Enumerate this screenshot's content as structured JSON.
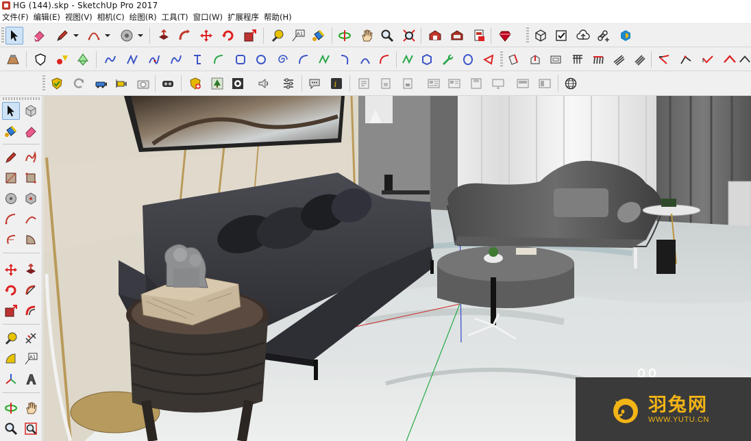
{
  "window": {
    "title": "HG (144).skp - SketchUp Pro 2017"
  },
  "menubar": {
    "items": [
      "文件(F)",
      "编辑(E)",
      "视图(V)",
      "相机(C)",
      "绘图(R)",
      "工具(T)",
      "窗口(W)",
      "扩展程序",
      "帮助(H)"
    ]
  },
  "toolbar_main": {
    "active_tool": "select",
    "tools": [
      "select",
      "eraser",
      "pencil",
      "dropdown",
      "arc",
      "dropdown",
      "protractor",
      "dropdown",
      "push-pull",
      "follow-me",
      "move",
      "rotate",
      "scale",
      "tape-measure",
      "text",
      "paint-bucket",
      "orbit",
      "pan",
      "zoom",
      "zoom-extents",
      "3d-warehouse",
      "extension-warehouse",
      "layout",
      "ruby-console",
      "component-options",
      "check",
      "cloud-upload",
      "add-link",
      "trimble-connect"
    ]
  },
  "toolbar_secondary": {
    "tools": [
      "sandbox",
      "shield",
      "gradient",
      "tree",
      "curve-a",
      "curve-b",
      "curve-c",
      "curve-d",
      "curve-e",
      "curve-f",
      "square",
      "circle",
      "spiral",
      "arc-a",
      "arc-b",
      "arc-c",
      "arc-d",
      "arc-e",
      "line-green",
      "polygon",
      "wrench",
      "ellipse",
      "triangle",
      "extrude-a",
      "extrude-b",
      "extrude-c",
      "grid",
      "rail",
      "fence",
      "blinds",
      "knife",
      "cut-a",
      "cut-b",
      "roof"
    ]
  },
  "toolbar_tertiary": {
    "tools": [
      "component-shield",
      "refresh",
      "camera-car",
      "camera-flag",
      "camera",
      "vr-goggles",
      "gold-shield",
      "tree-tile",
      "camera-lens",
      "speaker",
      "settings-sliders",
      "chat",
      "info",
      "doc-a",
      "doc-b",
      "doc-c",
      "doc-d",
      "doc-e",
      "doc-f",
      "doc-g",
      "doc-h",
      "doc-i",
      "doc-j",
      "globe"
    ]
  },
  "left_palette": {
    "active_tool": "select",
    "tools": [
      "select",
      "make-component",
      "paint-bucket",
      "eraser",
      "pencil",
      "freehand",
      "rectangle",
      "rotated-rectangle",
      "circle",
      "polygon",
      "arc",
      "two-point-arc",
      "three-point-arc",
      "pie",
      "move",
      "push-pull",
      "rotate",
      "follow-me",
      "scale",
      "offset",
      "tape-measure",
      "dimension",
      "protractor",
      "text",
      "axes",
      "3d-text",
      "orbit",
      "pan",
      "zoom",
      "zoom-window"
    ]
  },
  "watermark": {
    "name_cn": "羽兔网",
    "url": "WWW.YUTU.CN"
  }
}
